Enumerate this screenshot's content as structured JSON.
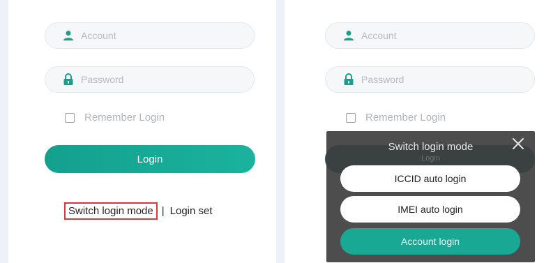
{
  "left": {
    "account_placeholder": "Account",
    "password_placeholder": "Password",
    "remember_label": "Remember Login",
    "login_label": "Login",
    "switch_mode_label": "Switch login mode",
    "separator": "|",
    "login_set_label": "Login set"
  },
  "right": {
    "account_placeholder": "Account",
    "password_placeholder": "Password",
    "remember_label": "Remember Login",
    "dialog": {
      "title": "Switch login mode",
      "behind_text": "Login",
      "options": [
        "ICCID auto login",
        "IMEI auto login",
        "Account login"
      ]
    }
  },
  "colors": {
    "accent": "#19a894",
    "highlight_box": "#d9383a",
    "dialog_bg": "#404040"
  }
}
